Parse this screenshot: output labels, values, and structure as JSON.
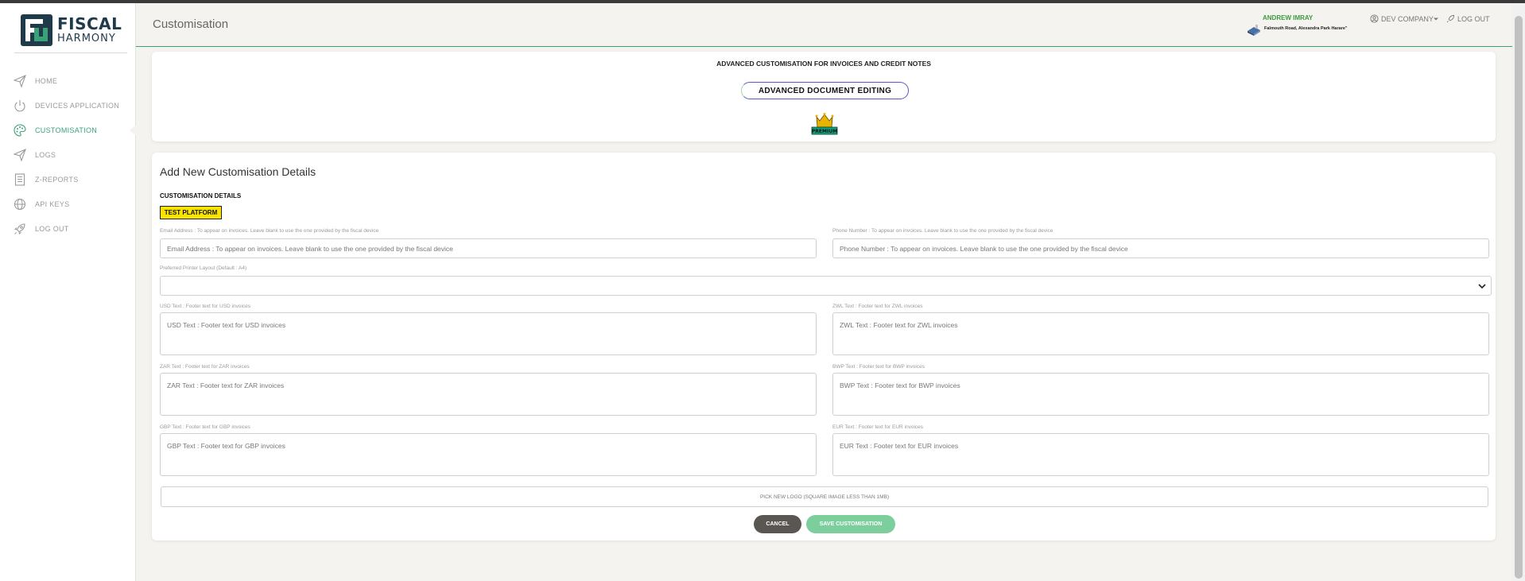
{
  "brand": {
    "name_line1": "FISCAL",
    "name_line2": "HARMONY",
    "accent_color": "#3aa278"
  },
  "sidebar": {
    "items": [
      {
        "label": "HOME",
        "icon": "send-icon",
        "active": false
      },
      {
        "label": "DEVICES APPLICATION",
        "icon": "power-icon",
        "active": false
      },
      {
        "label": "CUSTOMISATION",
        "icon": "palette-icon",
        "active": true
      },
      {
        "label": "LOGS",
        "icon": "send-icon",
        "active": false
      },
      {
        "label": "Z-REPORTS",
        "icon": "report-icon",
        "active": false
      },
      {
        "label": "API KEYS",
        "icon": "globe-icon",
        "active": false
      },
      {
        "label": "LOG OUT",
        "icon": "rocket-icon",
        "active": false
      }
    ]
  },
  "header": {
    "title": "Customisation",
    "user_name": "ANDREW IMRAY",
    "user_address": "Falmouth Road, Alexandra Park Harare\"",
    "company": "DEV COMPANY",
    "logout": "LOG OUT"
  },
  "premium_card": {
    "heading": "ADVANCED CUSTOMISATION FOR INVOICES AND CREDIT NOTES",
    "button_label": "ADVANCED DOCUMENT EDITING",
    "badge_text": "PREMIUM"
  },
  "form": {
    "title": "Add New Customisation Details",
    "section_label": "CUSTOMISATION DETAILS",
    "platform_badge": "TEST PLATFORM",
    "email": {
      "label": "Email Address : To appear on invoices. Leave blank to use the one provided by the fiscal device",
      "placeholder": "Email Address : To appear on invoices. Leave blank to use the one provided by the fiscal device"
    },
    "phone": {
      "label": "Phone Number : To appear on invoices. Leave blank to use the one provided by the fiscal device",
      "placeholder": "Phone Number : To appear on invoices. Leave blank to use the one provided by the fiscal device"
    },
    "printer_layout": {
      "label": "Preferred Printer Layout (Default : A4)",
      "value": ""
    },
    "usd": {
      "label": "USD Text : Footer text for USD invoices",
      "placeholder": "USD Text : Footer text for USD invoices"
    },
    "zwl": {
      "label": "ZWL Text : Footer text for ZWL invoices",
      "placeholder": "ZWL Text : Footer text for ZWL invoices"
    },
    "zar": {
      "label": "ZAR Text : Footer text for ZAR invoices",
      "placeholder": "ZAR Text : Footer text for ZAR invoices"
    },
    "bwp": {
      "label": "BWP Text : Footer text for BWP invoices",
      "placeholder": "BWP Text : Footer text for BWP invoices"
    },
    "gbp": {
      "label": "GBP Text : Footer text for GBP invoices",
      "placeholder": "GBP Text : Footer text for GBP invoices"
    },
    "eur": {
      "label": "EUR Text : Footer text for EUR invoices",
      "placeholder": "EUR Text : Footer text for EUR invoices"
    },
    "pick_logo": "PICK NEW LOGO (SQUARE IMAGE LESS THAN 1MB)",
    "cancel": "CANCEL",
    "save": "SAVE CUSTOMISATION"
  }
}
